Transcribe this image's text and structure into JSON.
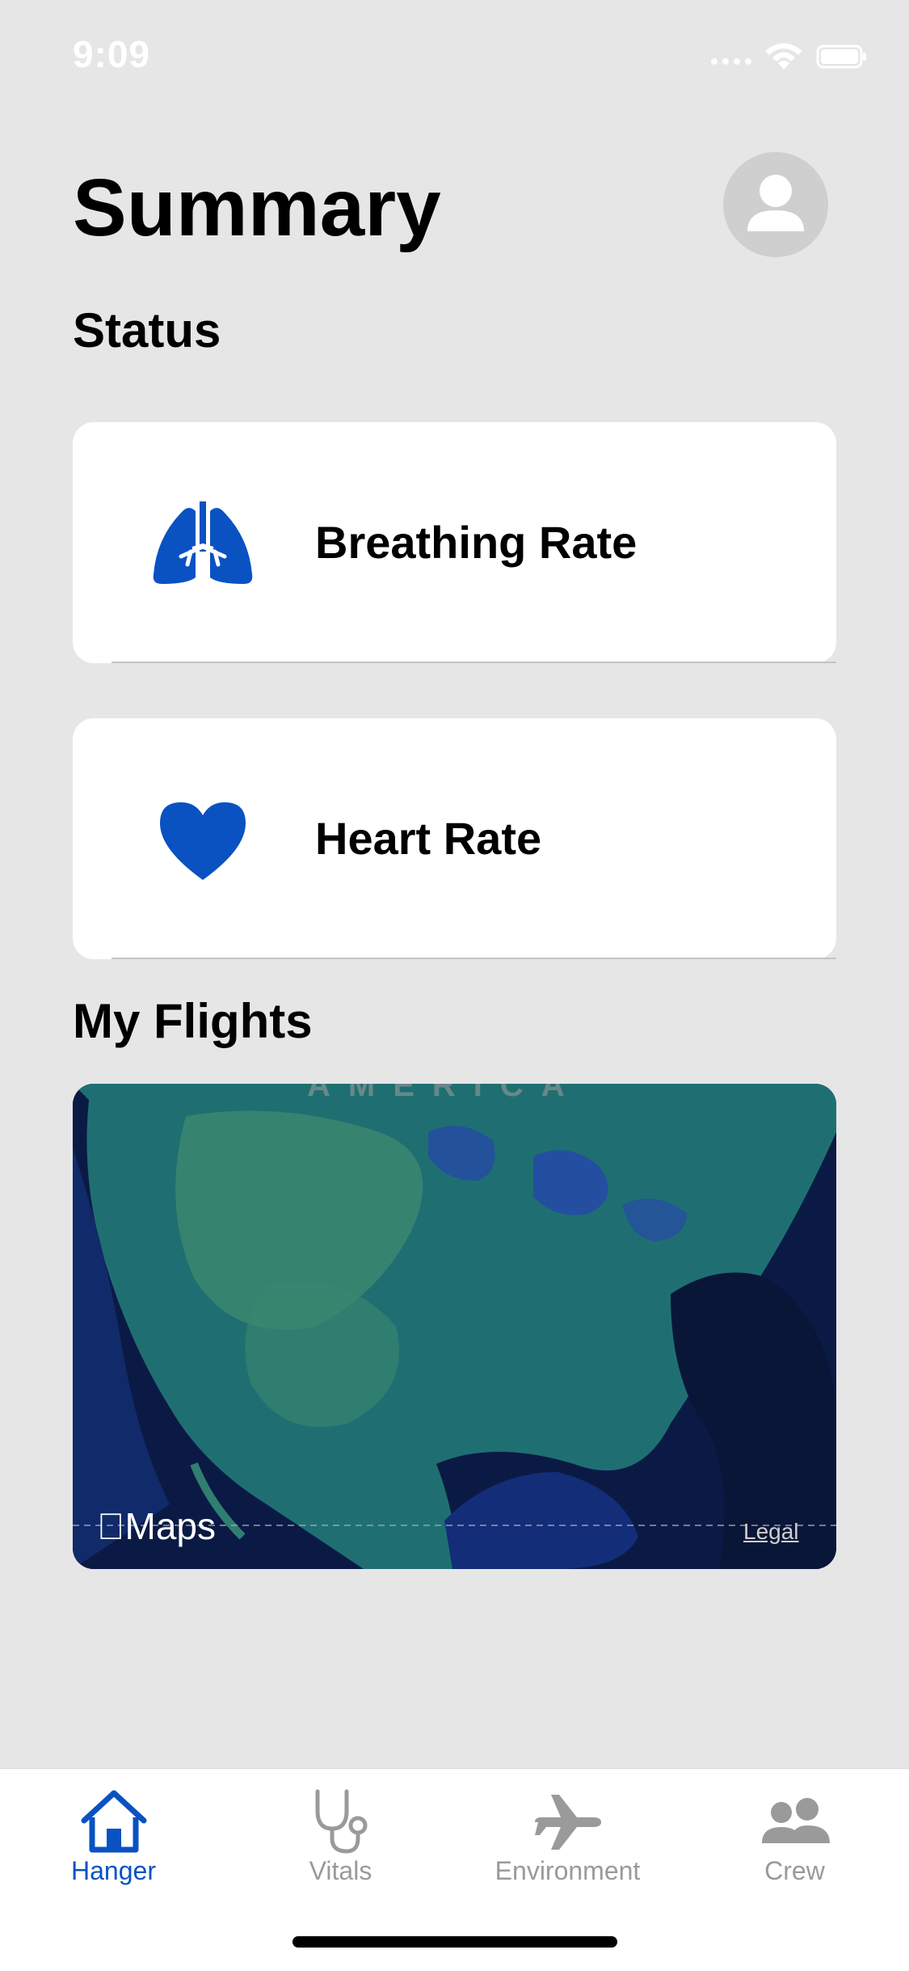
{
  "status_bar": {
    "time": "9:09"
  },
  "header": {
    "title": "Summary"
  },
  "sections": {
    "status": "Status",
    "flights": "My Flights"
  },
  "cards": [
    {
      "label": "Breathing Rate",
      "icon": "lungs-icon"
    },
    {
      "label": "Heart Rate",
      "icon": "heart-icon"
    }
  ],
  "map": {
    "region_label": "AMERICA",
    "attribution": "Maps",
    "legal": "Legal"
  },
  "tabs": [
    {
      "label": "Hanger",
      "icon": "home-icon",
      "active": true
    },
    {
      "label": "Vitals",
      "icon": "stethoscope-icon",
      "active": false
    },
    {
      "label": "Environment",
      "icon": "airplane-icon",
      "active": false
    },
    {
      "label": "Crew",
      "icon": "people-icon",
      "active": false
    }
  ],
  "colors": {
    "accent": "#0a52c2",
    "inactive": "#9a9a9a",
    "background": "#e6e6e6"
  }
}
